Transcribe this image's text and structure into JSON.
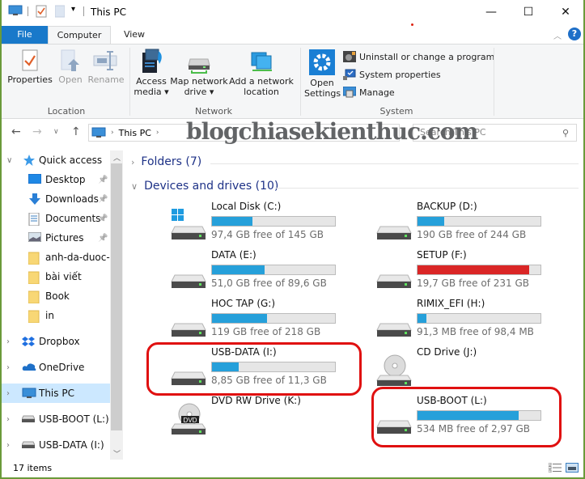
{
  "window": {
    "title": "This PC",
    "minimize": "—",
    "maximize": "☐",
    "close": "✕"
  },
  "ribbon": {
    "tabs": [
      {
        "label": "File",
        "active": false
      },
      {
        "label": "Computer",
        "active": true
      },
      {
        "label": "View",
        "active": false
      }
    ],
    "groups": {
      "location": {
        "label": "Location",
        "buttons": [
          {
            "label": "Properties",
            "enabled": true
          },
          {
            "label": "Open",
            "enabled": false
          },
          {
            "label": "Rename",
            "enabled": false
          }
        ]
      },
      "network": {
        "label": "Network",
        "buttons": [
          {
            "label_line1": "Access",
            "label_line2": "media ▾"
          },
          {
            "label_line1": "Map network",
            "label_line2": "drive ▾"
          },
          {
            "label_line1": "Add a network",
            "label_line2": "location"
          }
        ]
      },
      "system": {
        "label": "System",
        "open_settings_line1": "Open",
        "open_settings_line2": "Settings",
        "small_buttons": [
          {
            "label": "Uninstall or change a program"
          },
          {
            "label": "System properties"
          },
          {
            "label": "Manage"
          }
        ]
      }
    }
  },
  "navigation": {
    "breadcrumb": [
      "This PC"
    ],
    "search_placeholder": "Search This PC",
    "watermark": "blogchiasekienthuc.com"
  },
  "nav_pane": {
    "items": [
      {
        "label": "Quick access",
        "icon": "star-icon",
        "expanded": true
      },
      {
        "label": "Desktop",
        "icon": "desktop-icon",
        "pinned": true
      },
      {
        "label": "Downloads",
        "icon": "download-icon",
        "pinned": true
      },
      {
        "label": "Documents",
        "icon": "documents-icon",
        "pinned": true
      },
      {
        "label": "Pictures",
        "icon": "pictures-icon",
        "pinned": true
      },
      {
        "label": "anh-da-duoc-g",
        "icon": "folder-icon"
      },
      {
        "label": "bài viết",
        "icon": "folder-icon"
      },
      {
        "label": "Book",
        "icon": "folder-icon"
      },
      {
        "label": "in",
        "icon": "folder-icon"
      },
      {
        "label": "Dropbox",
        "icon": "dropbox-icon"
      },
      {
        "label": "OneDrive",
        "icon": "onedrive-icon"
      },
      {
        "label": "This PC",
        "icon": "computer-icon",
        "selected": true
      },
      {
        "label": "USB-BOOT (L:)",
        "icon": "usb-drive-icon"
      },
      {
        "label": "USB-DATA (I:)",
        "icon": "usb-drive-icon"
      }
    ]
  },
  "content": {
    "groups": [
      {
        "label": "Folders (7)",
        "expanded": false
      },
      {
        "label": "Devices and drives (10)",
        "expanded": true
      }
    ],
    "drives": [
      {
        "name": "Local Disk (C:)",
        "free": "97,4 GB free of 145 GB",
        "used_fraction": 0.33,
        "bar_color": "#26a0da",
        "icon": "windows-drive-icon"
      },
      {
        "name": "BACKUP (D:)",
        "free": "190 GB free of 244 GB",
        "used_fraction": 0.22,
        "bar_color": "#26a0da",
        "icon": "hard-drive-icon"
      },
      {
        "name": "DATA (E:)",
        "free": "51,0 GB free of 89,6 GB",
        "used_fraction": 0.43,
        "bar_color": "#26a0da",
        "icon": "hard-drive-icon"
      },
      {
        "name": "SETUP (F:)",
        "free": "19,7 GB free of 231 GB",
        "used_fraction": 0.91,
        "bar_color": "#da2626",
        "icon": "hard-drive-icon"
      },
      {
        "name": "HOC TAP (G:)",
        "free": "119 GB free of 218 GB",
        "used_fraction": 0.45,
        "bar_color": "#26a0da",
        "icon": "hard-drive-icon"
      },
      {
        "name": "RIMIX_EFI (H:)",
        "free": "91,3 MB free of 98,4 MB",
        "used_fraction": 0.07,
        "bar_color": "#26a0da",
        "icon": "hard-drive-icon"
      },
      {
        "name": "USB-DATA (I:)",
        "free": "8,85 GB free of 11,3 GB",
        "used_fraction": 0.22,
        "bar_color": "#26a0da",
        "icon": "hard-drive-icon",
        "highlighted": true
      },
      {
        "name": "CD Drive (J:)",
        "free": "",
        "icon": "cd-drive-icon"
      },
      {
        "name": "DVD RW Drive (K:)",
        "free": "",
        "icon": "dvd-drive-icon"
      },
      {
        "name": "USB-BOOT (L:)",
        "free": "534 MB free of 2,97 GB",
        "used_fraction": 0.82,
        "bar_color": "#26a0da",
        "icon": "hard-drive-icon",
        "highlighted": true
      }
    ]
  },
  "status_bar": {
    "item_count": "17 items"
  }
}
